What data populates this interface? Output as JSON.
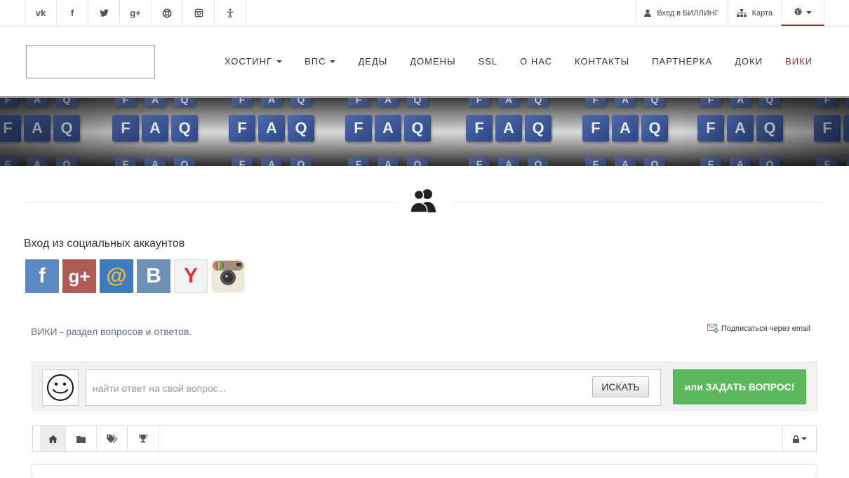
{
  "topbar": {
    "social_icons": [
      {
        "name": "vk-icon",
        "glyph": "vk"
      },
      {
        "name": "facebook-icon",
        "glyph": "f"
      },
      {
        "name": "twitter-icon",
        "glyph": ""
      },
      {
        "name": "google-plus-icon",
        "glyph": "g+"
      },
      {
        "name": "support-icon",
        "glyph": ""
      },
      {
        "name": "instagram-icon",
        "glyph": ""
      },
      {
        "name": "accessibility-icon",
        "glyph": ""
      }
    ],
    "billing_label": "Вход в БИЛЛИНГ",
    "map_label": "Карта",
    "language_icon": "globe-icon"
  },
  "nav": {
    "items": [
      {
        "label": "ХОСТИНГ",
        "dropdown": true
      },
      {
        "label": "ВПС",
        "dropdown": true
      },
      {
        "label": "ДЕДЫ",
        "dropdown": false
      },
      {
        "label": "ДОМЕНЫ",
        "dropdown": false
      },
      {
        "label": "SSL",
        "dropdown": false
      },
      {
        "label": "О НАС",
        "dropdown": false
      },
      {
        "label": "КОНТАКТЫ",
        "dropdown": false
      },
      {
        "label": "ПАРТНЁРКА",
        "dropdown": false
      },
      {
        "label": "ДОКИ",
        "dropdown": false
      },
      {
        "label": "ВИКИ",
        "dropdown": false,
        "active": true
      }
    ],
    "active_color": "#9b3030"
  },
  "banner": {
    "cube_letters": [
      "F",
      "A",
      "Q"
    ]
  },
  "social_login": {
    "title": "Вход из социальных аккаунтов",
    "buttons": [
      {
        "name": "facebook",
        "glyph": "f",
        "color": "#5b8ac0"
      },
      {
        "name": "google-plus",
        "glyph": "g+",
        "color": "#b05a55"
      },
      {
        "name": "mail-ru",
        "glyph": "@",
        "color": "#3f7bbf"
      },
      {
        "name": "vkontakte",
        "glyph": "B",
        "color": "#6f8fb5"
      },
      {
        "name": "yandex",
        "glyph": "Y",
        "color": "#f3f3f3"
      },
      {
        "name": "instagram",
        "glyph": "",
        "color": "#a58c74"
      }
    ]
  },
  "wiki": {
    "title": "ВИКИ",
    "separator": " - ",
    "description": "раздел вопросов и ответов.",
    "subscribe_label": "Подписаться через email"
  },
  "search": {
    "placeholder": "найти ответ на свой вопрос...",
    "button_label": "ИСКАТЬ",
    "ask_button_label": "или ЗАДАТЬ ВОПРОС!",
    "ask_color": "#5cb85c"
  },
  "tabs": [
    {
      "name": "home-icon"
    },
    {
      "name": "folder-icon"
    },
    {
      "name": "tags-icon"
    },
    {
      "name": "trophy-icon"
    }
  ]
}
